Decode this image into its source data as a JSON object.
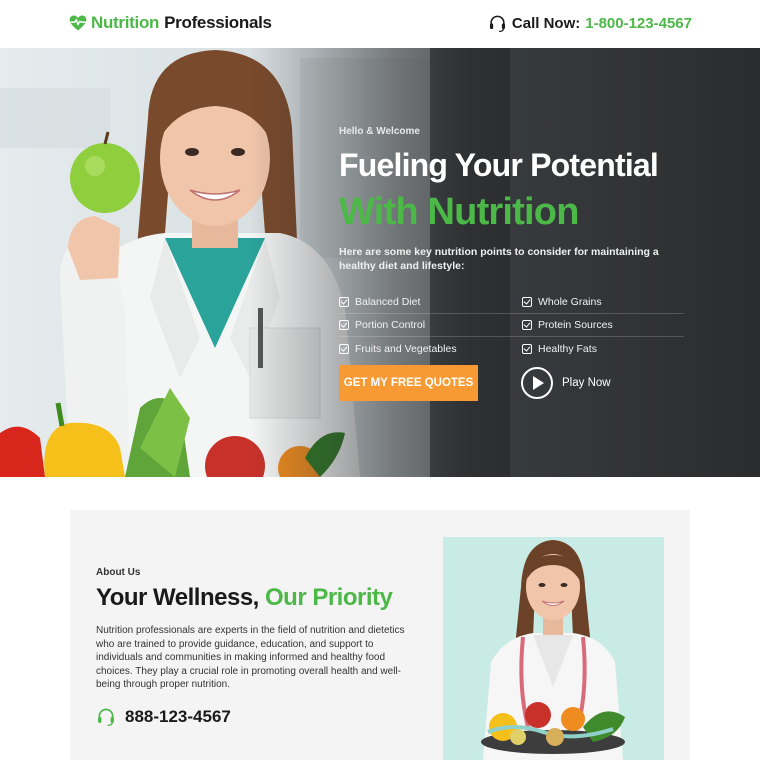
{
  "header": {
    "logo_part1": "Nutrition",
    "logo_part2": "Professionals",
    "call_label": "Call Now:",
    "call_number": "1-800-123-4567"
  },
  "hero": {
    "greeting": "Hello & Welcome",
    "headline_line1": "Fueling Your Potential",
    "headline_line2": "With Nutrition",
    "description": "Here are some key nutrition points to consider for maintaining a healthy diet and lifestyle:",
    "points": [
      "Balanced Diet",
      "Whole Grains",
      "Portion Control",
      "Protein Sources",
      "Fruits and Vegetables",
      "Healthy Fats"
    ],
    "cta_label": "GET MY FREE QUOTES",
    "play_label": "Play Now"
  },
  "about": {
    "eyebrow": "About Us",
    "title_part1": "Your Wellness,",
    "title_part2": "Our Priority",
    "body": "Nutrition professionals are experts in the field of nutrition and dietetics who are trained to provide guidance, education, and support to individuals and communities in making informed and healthy food choices. They play a crucial role in promoting overall health and well-being through proper nutrition.",
    "phone": "888-123-4567"
  },
  "colors": {
    "brand_green": "#4cb848",
    "cta_orange": "#f79a33",
    "hero_dark": "#2a2c2e",
    "about_bg": "#f4f4f4",
    "photo_bg": "#c9ebe6"
  },
  "icons": {
    "logo": "heart-pulse-icon",
    "call": "headset-icon",
    "point": "checkbox-icon",
    "play": "play-icon",
    "phone": "headset-icon"
  }
}
